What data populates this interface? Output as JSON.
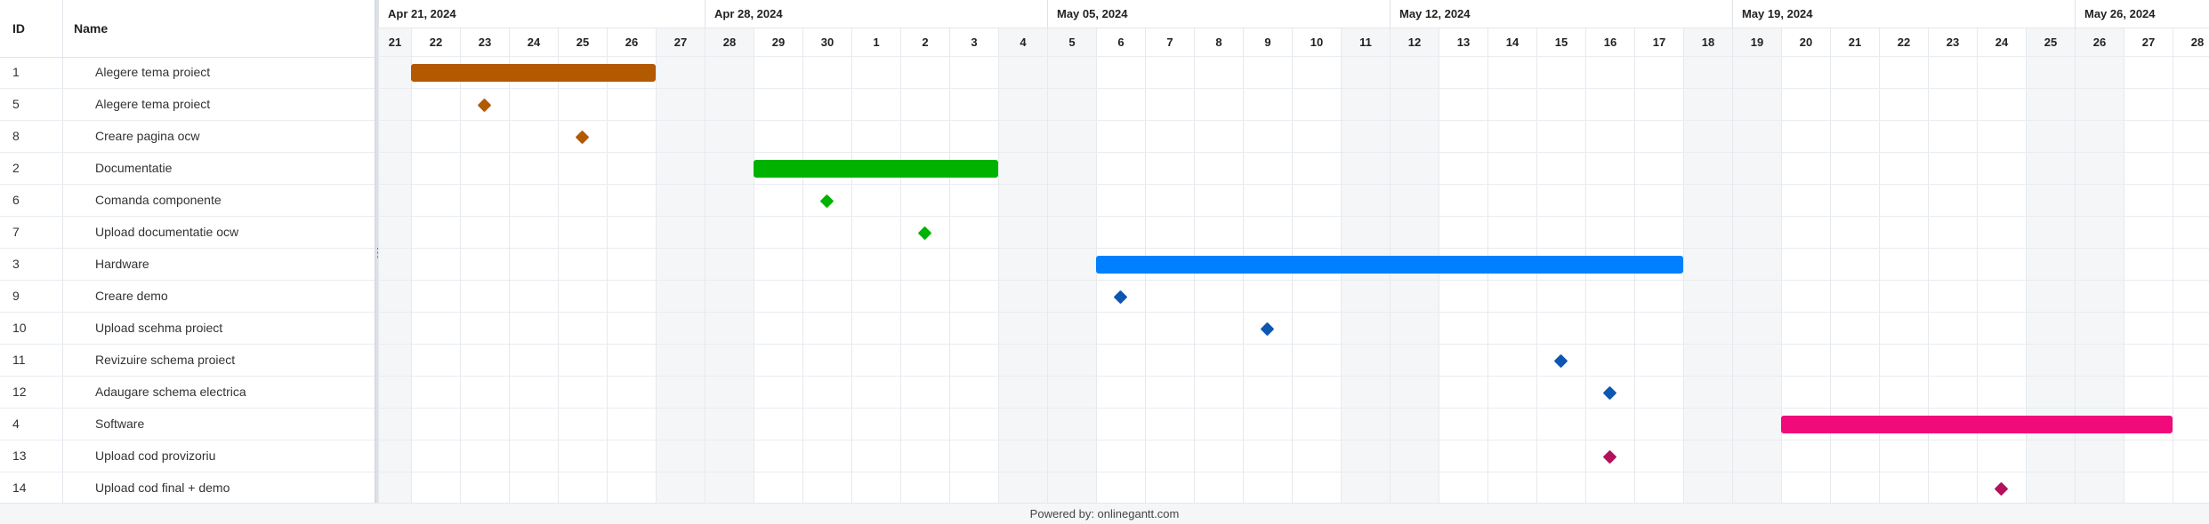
{
  "columns": {
    "id": "ID",
    "name": "Name"
  },
  "tasks": [
    {
      "id": "1",
      "name": "Alegere tema proiect",
      "type": "task",
      "start": "2024-04-22",
      "end": "2024-04-26",
      "color": "#b35900"
    },
    {
      "id": "5",
      "name": "Alegere tema proiect",
      "type": "milestone",
      "date": "2024-04-23",
      "color": "#b35900"
    },
    {
      "id": "8",
      "name": "Creare pagina ocw",
      "type": "milestone",
      "date": "2024-04-25",
      "color": "#b35900"
    },
    {
      "id": "2",
      "name": "Documentatie",
      "type": "task",
      "start": "2024-04-29",
      "end": "2024-05-03",
      "color": "#00b300"
    },
    {
      "id": "6",
      "name": "Comanda componente",
      "type": "milestone",
      "date": "2024-04-30",
      "color": "#00b300"
    },
    {
      "id": "7",
      "name": "Upload documentatie ocw",
      "type": "milestone",
      "date": "2024-05-02",
      "color": "#00b300"
    },
    {
      "id": "3",
      "name": "Hardware",
      "type": "task",
      "start": "2024-05-06",
      "end": "2024-05-17",
      "color": "#0080ff"
    },
    {
      "id": "9",
      "name": "Creare demo",
      "type": "milestone",
      "date": "2024-05-06",
      "color": "#0d56b3"
    },
    {
      "id": "10",
      "name": "Upload scehma proiect",
      "type": "milestone",
      "date": "2024-05-09",
      "color": "#0d56b3"
    },
    {
      "id": "11",
      "name": "Revizuire schema proiect",
      "type": "milestone",
      "date": "2024-05-15",
      "color": "#0d56b3"
    },
    {
      "id": "12",
      "name": "Adaugare schema electrica",
      "type": "milestone",
      "date": "2024-05-16",
      "color": "#0d56b3"
    },
    {
      "id": "4",
      "name": "Software",
      "type": "task",
      "start": "2024-05-20",
      "end": "2024-05-27",
      "color": "#f00a7a"
    },
    {
      "id": "13",
      "name": "Upload cod provizoriu",
      "type": "milestone",
      "date": "2024-05-16",
      "color": "#b3125a"
    },
    {
      "id": "14",
      "name": "Upload cod final + demo",
      "type": "milestone",
      "date": "2024-05-24",
      "color": "#b3125a"
    }
  ],
  "timeline": {
    "weeks": [
      "Apr 21, 2024",
      "Apr 28, 2024",
      "May 05, 2024",
      "May 12, 2024",
      "May 19, 2024",
      "May 26, 2024"
    ],
    "days": [
      "21",
      "22",
      "23",
      "24",
      "25",
      "26",
      "27",
      "28",
      "29",
      "30",
      "1",
      "2",
      "3",
      "4",
      "5",
      "6",
      "7",
      "8",
      "9",
      "10",
      "11",
      "12",
      "13",
      "14",
      "15",
      "16",
      "17",
      "18",
      "19",
      "20",
      "21",
      "22",
      "23",
      "24",
      "25",
      "26",
      "27",
      "28"
    ],
    "start_date": "2024-04-21"
  },
  "footer": "Powered by: onlinegantt.com"
}
